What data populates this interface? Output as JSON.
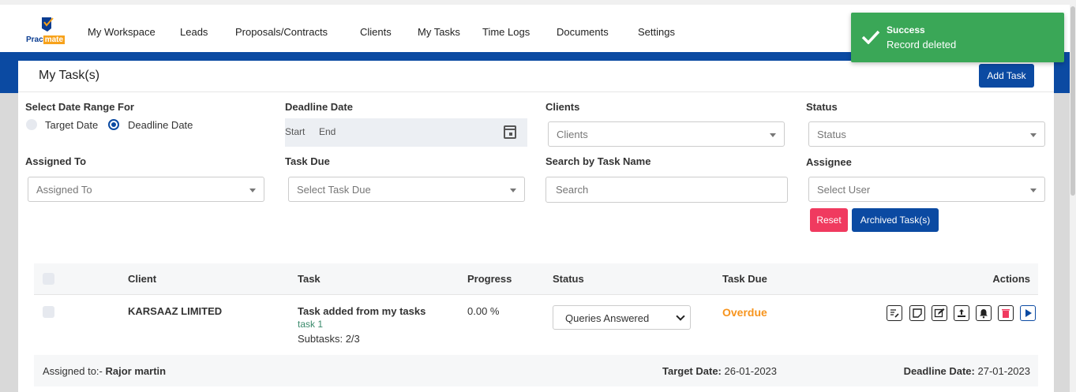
{
  "app": {
    "logo_left": "Prac",
    "logo_right": "mate"
  },
  "nav": {
    "items": [
      "My Workspace",
      "Leads",
      "Proposals/Contracts",
      "Clients",
      "My Tasks",
      "Time Logs",
      "Documents",
      "Settings"
    ]
  },
  "toast": {
    "title": "Success",
    "message": "Record deleted",
    "color": "#3aa757"
  },
  "page": {
    "title": "My Task(s)",
    "add_button": "Add Task"
  },
  "filters": {
    "date_range_label": "Select Date Range For",
    "radio_target": "Target Date",
    "radio_deadline": "Deadline Date",
    "radio_selected": "Deadline Date",
    "deadline_label": "Deadline Date",
    "start_label": "Start",
    "end_label": "End",
    "clients_label": "Clients",
    "clients_placeholder": "Clients",
    "status_label": "Status",
    "status_placeholder": "Status",
    "assigned_label": "Assigned To",
    "assigned_placeholder": "Assigned To",
    "taskdue_label": "Task Due",
    "taskdue_placeholder": "Select Task Due",
    "search_label": "Search by Task Name",
    "search_placeholder": "Search",
    "assignee_label": "Assignee",
    "assignee_placeholder": "Select User",
    "reset_button": "Reset",
    "archived_button": "Archived Task(s)"
  },
  "table": {
    "headers": {
      "client": "Client",
      "task": "Task",
      "progress": "Progress",
      "status": "Status",
      "task_due": "Task Due",
      "actions": "Actions"
    },
    "rows": [
      {
        "client": "KARSAAZ LIMITED",
        "task_title": "Task added from my tasks",
        "task_sub": "task 1",
        "subtasks": "Subtasks: 2/3",
        "progress": "0.00 %",
        "status": "Queries Answered",
        "task_due": "Overdue",
        "assigned_prefix": "Assigned to:-",
        "assigned_name": "Rajor martin",
        "target_label": "Target Date:",
        "target_value": "26-01-2023",
        "deadline_label": "Deadline Date:",
        "deadline_value": "27-01-2023",
        "actions": [
          "edit-note-icon",
          "sticky-note-icon",
          "edit-icon",
          "upload-icon",
          "bell-icon",
          "trash-icon",
          "play-icon"
        ]
      }
    ]
  },
  "colors": {
    "brand_blue": "#0b4aa2",
    "danger": "#f03a5f",
    "overdue": "#f7941d"
  }
}
